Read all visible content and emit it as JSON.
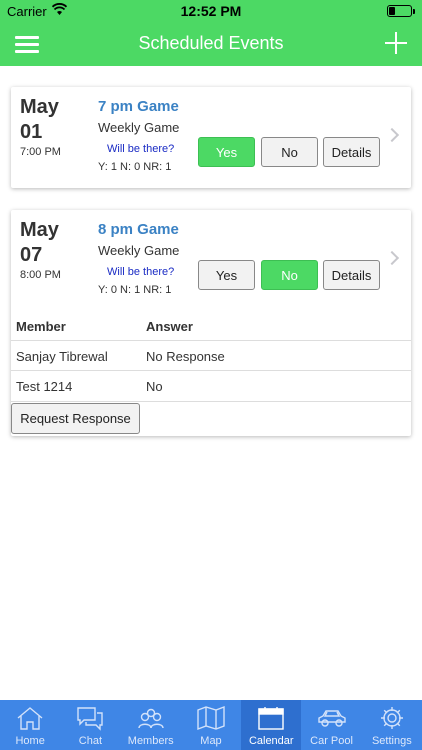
{
  "status_bar": {
    "carrier": "Carrier",
    "time": "12:52 PM"
  },
  "header": {
    "title": "Scheduled Events",
    "menu_icon": "hamburger-icon",
    "add_icon": "plus-icon"
  },
  "colors": {
    "green": "#4cd964",
    "link_blue": "#3b82c4",
    "tab_blue": "#3f86e6"
  },
  "events": [
    {
      "month": "May",
      "day": "01",
      "time": "7:00 PM",
      "title": "7 pm Game",
      "type": "Weekly Game",
      "question": "Will be there?",
      "counts": "Y: 1 N: 0 NR: 1",
      "yes_label": "Yes",
      "no_label": "No",
      "details_label": "Details",
      "selected": "Yes"
    },
    {
      "month": "May",
      "day": "07",
      "time": "8:00 PM",
      "title": "8 pm Game",
      "type": "Weekly Game",
      "question": "Will be there?",
      "counts": "Y: 0 N: 1 NR: 1",
      "yes_label": "Yes",
      "no_label": "No",
      "details_label": "Details",
      "selected": "No",
      "responses": {
        "headers": [
          "Member",
          "Answer"
        ],
        "rows": [
          {
            "member": "Sanjay Tibrewal",
            "answer": "No Response"
          },
          {
            "member": "Test 1214",
            "answer": "No"
          }
        ],
        "request_label": "Request Response"
      }
    }
  ],
  "tabs": [
    {
      "label": "Home",
      "icon": "home-icon"
    },
    {
      "label": "Chat",
      "icon": "chat-icon"
    },
    {
      "label": "Members",
      "icon": "members-icon"
    },
    {
      "label": "Map",
      "icon": "map-icon"
    },
    {
      "label": "Calendar",
      "icon": "calendar-icon",
      "active": true
    },
    {
      "label": "Car Pool",
      "icon": "car-icon"
    },
    {
      "label": "Settings",
      "icon": "gear-icon"
    }
  ]
}
